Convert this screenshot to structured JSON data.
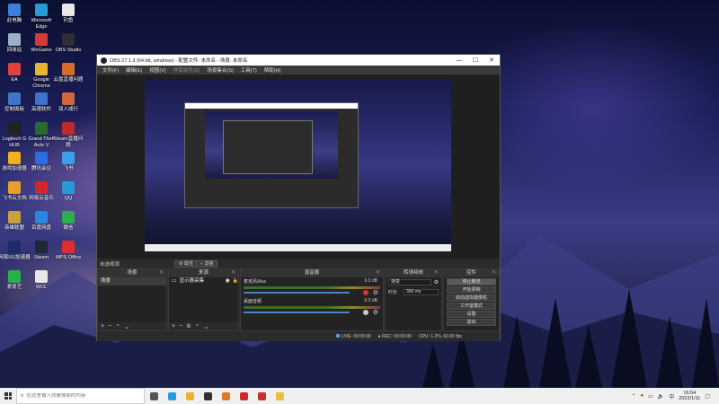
{
  "desktop": {
    "icons": [
      {
        "label": "此电脑",
        "color": "#3d7fd8"
      },
      {
        "label": "Microsoft Edge",
        "color": "#2a9ad6"
      },
      {
        "label": "钓鱼",
        "color": "#e8e8e8"
      },
      {
        "label": "回收站",
        "color": "#9ab0c8"
      },
      {
        "label": "WeGame",
        "color": "#d43a3a"
      },
      {
        "label": "OBS Studio",
        "color": "#302e31"
      },
      {
        "label": "EA",
        "color": "#e04040"
      },
      {
        "label": "Google Chrome",
        "color": "#e8b530"
      },
      {
        "label": "云盘直播问题",
        "color": "#d96b2a"
      },
      {
        "label": "控制面板",
        "color": "#3b78c8"
      },
      {
        "label": "高德软件",
        "color": "#3c74c9"
      },
      {
        "label": "双人成行",
        "color": "#d0663a"
      },
      {
        "label": "Logitech G HUB",
        "color": "#222222"
      },
      {
        "label": "Grand Theft Auto V",
        "color": "#2a6a2e"
      },
      {
        "label": "Steam直播问题",
        "color": "#c02a2a"
      },
      {
        "label": "游戏加速器",
        "color": "#f0b020"
      },
      {
        "label": "腾讯会议",
        "color": "#2d6de0"
      },
      {
        "label": "飞书",
        "color": "#3ca0e8"
      },
      {
        "label": "飞书云文档",
        "color": "#e8a02a"
      },
      {
        "label": "网易云音乐",
        "color": "#d02828"
      },
      {
        "label": "QQ",
        "color": "#2a9ad6"
      },
      {
        "label": "英雄联盟",
        "color": "#c8a040"
      },
      {
        "label": "百度网盘",
        "color": "#2a86e0"
      },
      {
        "label": "微信",
        "color": "#2ab04a"
      },
      {
        "label": "网易UU加速器",
        "color": "#1e2a6a"
      },
      {
        "label": "Steam",
        "color": "#1b2838"
      },
      {
        "label": "WPS Office",
        "color": "#d83030"
      },
      {
        "label": "爱奇艺",
        "color": "#2ab04a"
      },
      {
        "label": "WCL",
        "color": "#e8e8e8"
      }
    ]
  },
  "obs": {
    "title": "OBS 27.1.3 (64-bit, windows) - 配置文件: 未命名 - 场景: 未命名",
    "window_buttons": [
      "—",
      "☐",
      "✕"
    ],
    "menu": [
      "文件(F)",
      "编辑(E)",
      "视图(V)",
      "停靠部件(D)",
      "场景集合(S)",
      "工具(T)",
      "帮助(H)"
    ],
    "no_source_selected": "未选择源",
    "properties_btn": "属性",
    "filters_btn": "滤镜",
    "docks": {
      "scenes": {
        "title": "场景",
        "items": [
          "场景"
        ]
      },
      "sources": {
        "title": "来源",
        "items": [
          "显示器采集"
        ]
      },
      "mixer": {
        "title": "混音器",
        "tracks": [
          {
            "name": "麦克风/Aux",
            "db": "0.0 dB",
            "muted": true
          },
          {
            "name": "桌面音频",
            "db": "0.0 dB",
            "muted": false
          }
        ]
      },
      "transitions": {
        "title": "转场特效",
        "type": "渐变",
        "duration_label": "时长",
        "duration_value": "300 ms"
      },
      "controls": {
        "title": "控件",
        "buttons": [
          "停止推流",
          "开始录制",
          "启动虚拟摄像机",
          "工作室模式",
          "设置",
          "退出"
        ],
        "active_index": 0
      }
    },
    "status": {
      "live": "LIVE: 00:00:00",
      "rec": "REC: 00:00:00",
      "cpu": "CPU: 1.2%, 60.00 fps"
    }
  },
  "taskbar": {
    "search_placeholder": "在这里输入你要搜索的内容",
    "apps": [
      {
        "name": "task-view",
        "color": "#555555"
      },
      {
        "name": "edge",
        "color": "#2a9ad6"
      },
      {
        "name": "chrome",
        "color": "#e8b530"
      },
      {
        "name": "obs",
        "color": "#302e31"
      },
      {
        "name": "app-orange",
        "color": "#e07a2a"
      },
      {
        "name": "netease",
        "color": "#d02828"
      },
      {
        "name": "app-red",
        "color": "#c83030"
      },
      {
        "name": "file-explorer",
        "color": "#e8c040"
      }
    ],
    "tray_ime": "中",
    "time": "16:54",
    "date": "2022/1/11"
  }
}
